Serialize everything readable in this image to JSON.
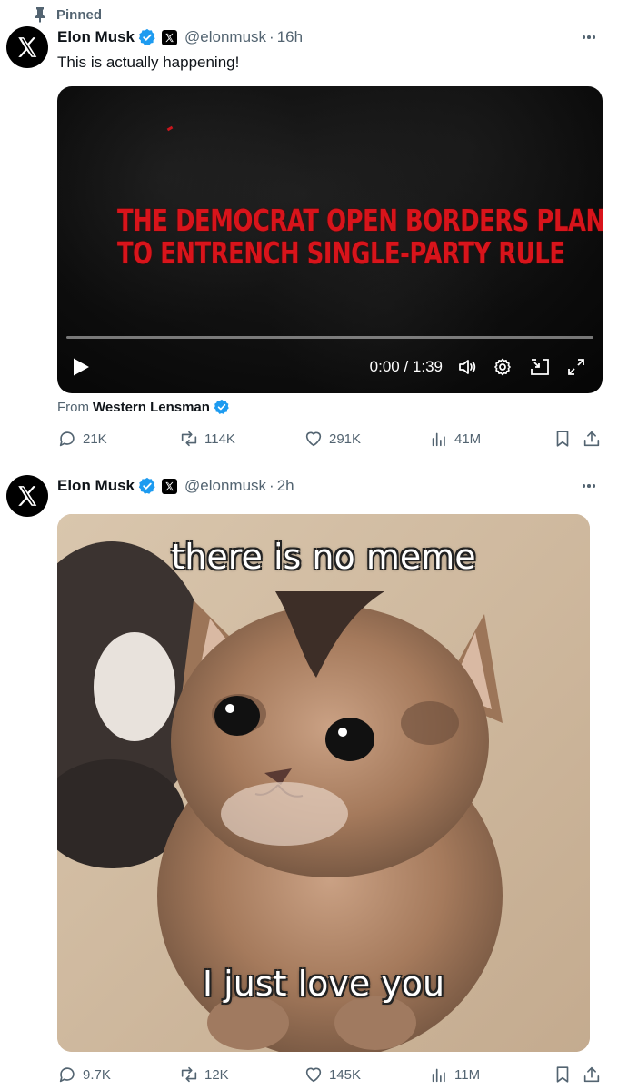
{
  "colors": {
    "verified": "#1d9bf0",
    "muted": "#536471",
    "text": "#0f1419",
    "headline_red": "#d8141b"
  },
  "tweets": [
    {
      "pinned_label": "Pinned",
      "author": "Elon Musk",
      "handle": "@elonmusk",
      "separator": "·",
      "time": "16h",
      "text": "This is actually happening!",
      "media": {
        "type": "video",
        "headline": [
          "THE DEMOCRAT OPEN BORDERS PLAN",
          "TO ENTRENCH SINGLE-PARTY RULE"
        ],
        "time_display": "0:00 / 1:39",
        "progress": 0
      },
      "source_prefix": "From",
      "source_name": "Western Lensman",
      "stats": {
        "replies": "21K",
        "reposts": "114K",
        "likes": "291K",
        "views": "41M"
      }
    },
    {
      "author": "Elon Musk",
      "handle": "@elonmusk",
      "separator": "·",
      "time": "2h",
      "media": {
        "type": "image",
        "top_caption": "there is no meme",
        "bottom_caption": "I just love you"
      },
      "stats": {
        "replies": "9.7K",
        "reposts": "12K",
        "likes": "145K",
        "views": "11M"
      }
    }
  ],
  "icons": {
    "pin": "pin-icon",
    "avatar": "x-logo-icon",
    "verified": "verified-badge-icon",
    "affiliate": "x-affiliate-badge-icon",
    "more": "more-icon",
    "play": "play-icon",
    "volume": "volume-icon",
    "settings": "gear-icon",
    "pip": "picture-in-picture-icon",
    "fullscreen": "fullscreen-icon",
    "reply": "reply-icon",
    "repost": "repost-icon",
    "like": "heart-icon",
    "views": "views-icon",
    "bookmark": "bookmark-icon",
    "share": "share-icon"
  }
}
